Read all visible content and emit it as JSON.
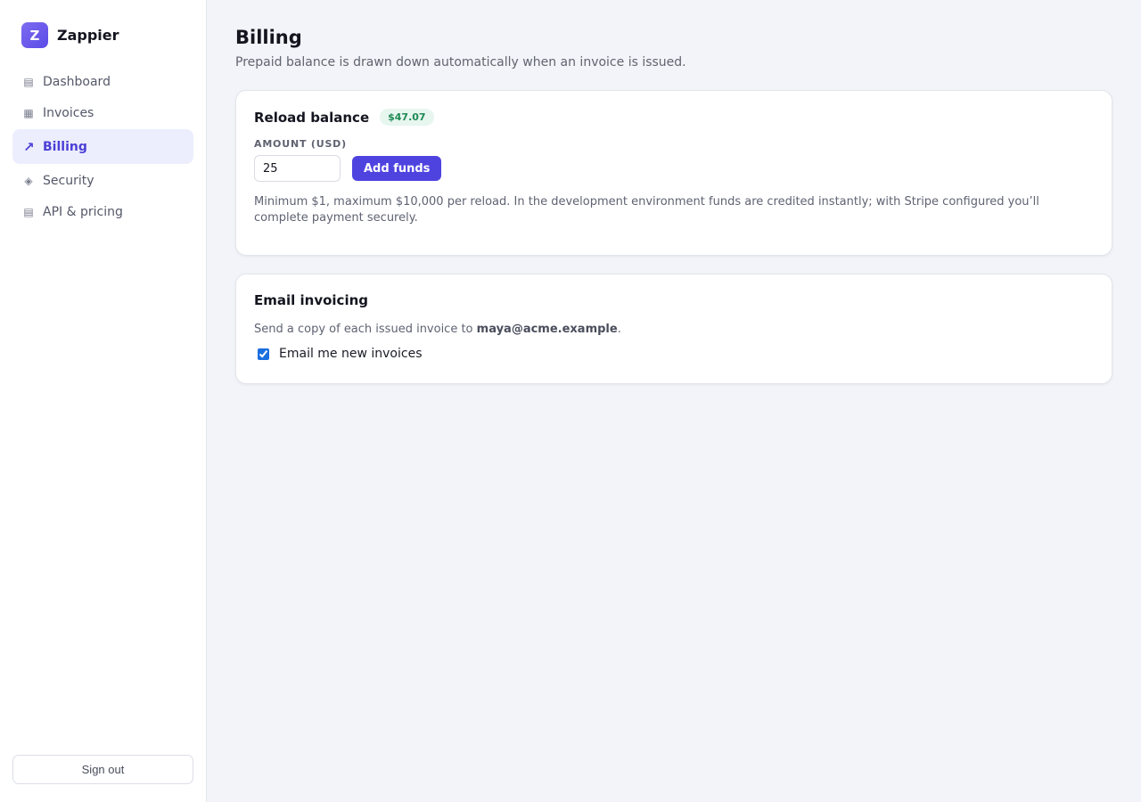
{
  "brand": {
    "logo_letter": "Z",
    "name": "Zappier"
  },
  "sidebar": {
    "items": [
      {
        "label": "Dashboard",
        "icon": "list-icon",
        "glyph": "▤"
      },
      {
        "label": "Invoices",
        "icon": "grid-icon",
        "glyph": "▦"
      },
      {
        "label": "Billing",
        "icon": "trend-arrow-icon",
        "glyph": "↗",
        "active": true
      },
      {
        "label": "Security",
        "icon": "diamond-icon",
        "glyph": "◈"
      },
      {
        "label": "API & pricing",
        "icon": "list-icon",
        "glyph": "▤"
      }
    ],
    "sign_out": "Sign out"
  },
  "page": {
    "title": "Billing",
    "subtitle": "Prepaid balance is drawn down automatically when an invoice is issued."
  },
  "reload": {
    "title": "Reload balance",
    "balance": "$47.07",
    "amount_label": "AMOUNT (USD)",
    "amount_value": "25",
    "add_button": "Add funds",
    "help": "Minimum $1, maximum $10,000 per reload. In the development environment funds are credited instantly; with Stripe configured you’ll complete payment securely."
  },
  "email": {
    "title": "Email invoicing",
    "desc_prefix": "Send a copy of each issued invoice to ",
    "address": "maya@acme.example",
    "desc_suffix": ".",
    "checkbox_label": "Email me new invoices",
    "checked": true
  },
  "colors": {
    "accent": "#4f43e0",
    "active_nav_bg": "#eceefd",
    "badge_bg": "#e7f6ef",
    "badge_text": "#1f8a55"
  }
}
